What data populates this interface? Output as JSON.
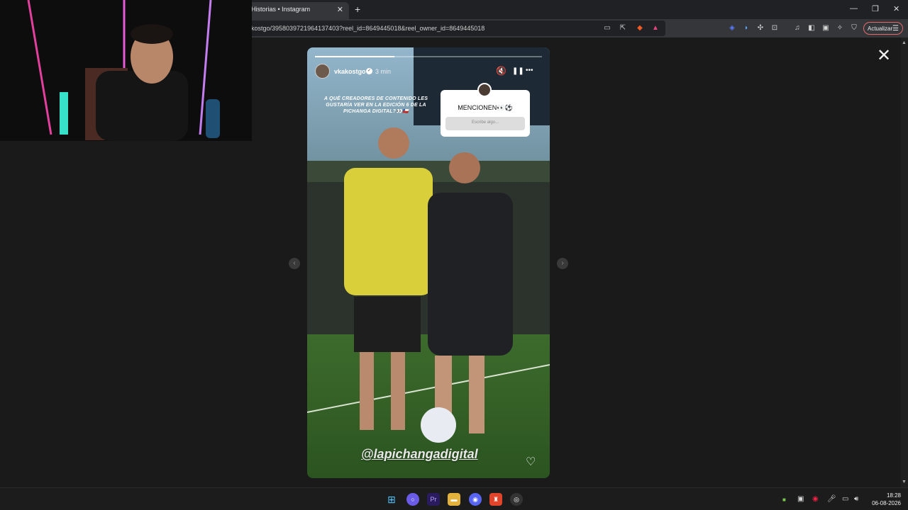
{
  "browser": {
    "tab_title": "Historias • Instagram",
    "tab_close": "✕",
    "new_tab": "+",
    "url": "kostgo/3958039721964137403?reel_id=8649445018&reel_owner_id=8649445018",
    "update_label": "Actualizar",
    "window": {
      "minimize": "—",
      "restore": "❐",
      "close": "✕"
    }
  },
  "story": {
    "username": "vkakostgo",
    "time": "3 min",
    "progress": 0.35,
    "question_text": "A QUÉ CREADORES DE CONTENIDO LES GUSTARÍA VER EN LA EDICIÓN 6 DE LA PICHANGA DIGITAL?👀🇨🇱",
    "question_box": {
      "title": "MENCIONEN👀⚽",
      "placeholder": "Escribe algo..."
    },
    "mention": "@lapichangadigital",
    "icons": {
      "mute": "🔇",
      "pause": "❚❚",
      "more": "•••",
      "like": "♡",
      "verified": "✓"
    }
  },
  "viewer": {
    "close": "✕",
    "prev": "‹",
    "next": "›"
  },
  "taskbar": {
    "time": "18:28",
    "date": "06-08-2026"
  }
}
